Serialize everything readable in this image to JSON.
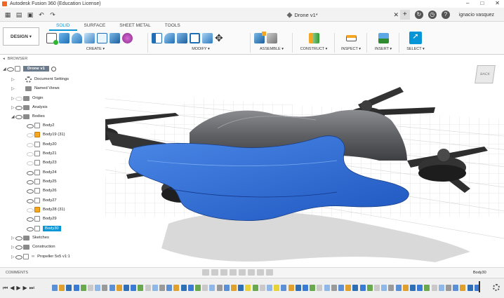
{
  "window": {
    "title": "Autodesk Fusion 360 (Education License)",
    "controls": [
      "–",
      "□",
      "✕"
    ]
  },
  "doc_tab": {
    "title": "Drone v1*",
    "close": "✕"
  },
  "user": {
    "name": "ignacio vasquez"
  },
  "workspace": {
    "label": "DESIGN ▾"
  },
  "toolbar": {
    "tabs": [
      {
        "label": "SOLID",
        "active": true
      },
      {
        "label": "SURFACE",
        "active": false
      },
      {
        "label": "SHEET METAL",
        "active": false
      },
      {
        "label": "TOOLS",
        "active": false
      }
    ],
    "groups": {
      "create": "CREATE ▾",
      "modify": "MODIFY ▾",
      "assemble": "ASSEMBLE ▾",
      "construct": "CONSTRUCT ▾",
      "inspect": "INSPECT ▾",
      "insert": "INSERT ▾",
      "select": "SELECT ▾"
    }
  },
  "browser": {
    "header": "BROWSER",
    "root": "Drone v1",
    "nodes": [
      {
        "label": "Document Settings",
        "type": "gear"
      },
      {
        "label": "Named Views",
        "type": "folder"
      },
      {
        "label": "Origin",
        "type": "folder"
      },
      {
        "label": "Analysis",
        "type": "folder"
      },
      {
        "label": "Bodies",
        "type": "folder"
      },
      {
        "label": "Body2",
        "type": "body"
      },
      {
        "label": "Body19 (31)",
        "type": "body-warn"
      },
      {
        "label": "Body20",
        "type": "body"
      },
      {
        "label": "Body21",
        "type": "body"
      },
      {
        "label": "Body23",
        "type": "body"
      },
      {
        "label": "Body24",
        "type": "body"
      },
      {
        "label": "Body25",
        "type": "body"
      },
      {
        "label": "Body26",
        "type": "body"
      },
      {
        "label": "Body27",
        "type": "body"
      },
      {
        "label": "Body28 (31)",
        "type": "body-warn"
      },
      {
        "label": "Body29",
        "type": "body"
      },
      {
        "label": "Body30",
        "type": "body",
        "selected": true
      },
      {
        "label": "Sketches",
        "type": "folder"
      },
      {
        "label": "Construction",
        "type": "folder"
      },
      {
        "label": "Propeller 5x5 v1:1",
        "type": "component"
      }
    ]
  },
  "viewcube": {
    "face_label": "BACK"
  },
  "comments": {
    "label": "COMMENTS",
    "status": "Body30"
  },
  "colors": {
    "accent": "#0696d7",
    "selection_blue": "#2f6fd6",
    "body_gray": "#6d6f73"
  }
}
